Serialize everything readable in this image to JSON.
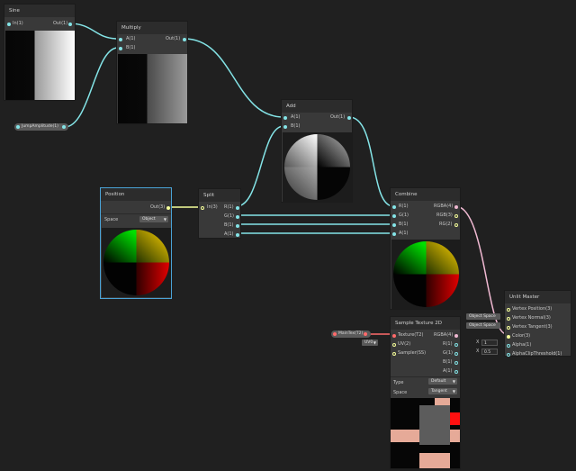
{
  "nodes": {
    "sine": {
      "title": "Sine",
      "in": "In(1)",
      "out": "Out(1)"
    },
    "multiply": {
      "title": "Multiply",
      "a": "A(1)",
      "b": "B(1)",
      "out": "Out(1)"
    },
    "add": {
      "title": "Add",
      "a": "A(1)",
      "b": "B(1)",
      "out": "Out(1)"
    },
    "position": {
      "title": "Position",
      "out": "Out(3)",
      "space_label": "Space",
      "space_value": "Object"
    },
    "split": {
      "title": "Split",
      "in": "In(3)",
      "r": "R(1)",
      "g": "G(1)",
      "b": "B(1)",
      "a": "A(1)"
    },
    "combine": {
      "title": "Combine",
      "r": "R(1)",
      "g": "G(1)",
      "b": "B(1)",
      "a": "A(1)",
      "rgba": "RGBA(4)",
      "rgb": "RGB(3)",
      "rg": "RG(2)"
    },
    "master": {
      "title": "Unlit Master",
      "ports": [
        "Vertex Position(3)",
        "Vertex Normal(3)",
        "Vertex Tangent(3)",
        "Color(3)",
        "Alpha(1)",
        "AlphaClipThreshold(1)"
      ],
      "vp_space": "Object Space",
      "vn_space": "Object Space",
      "alpha_value": "1",
      "clip_value": "0.5",
      "x_label": "X"
    },
    "sample": {
      "title": "Sample Texture 2D",
      "inputs": [
        "Texture(T2)",
        "UV(2)",
        "Sampler(SS)"
      ],
      "outputs": [
        "RGBA(4)",
        "R(1)",
        "G(1)",
        "B(1)",
        "A(1)"
      ],
      "type_label": "Type",
      "type_value": "Default",
      "space_label": "Space",
      "space_value": "Tangent",
      "uv_value": "UV0"
    }
  },
  "properties": {
    "jump": "JumpAmplitude(1)",
    "maintex": "MainTex(T2)"
  },
  "colors": {
    "background": "#202020",
    "node": "#393939",
    "title": "#2c2c2c",
    "float_port": "#84e4e7",
    "vector3_port": "#f6ff9a",
    "vector4_port": "#f0b9d2",
    "texture_port": "#ff6a6a",
    "selection": "#4aa3d6"
  }
}
